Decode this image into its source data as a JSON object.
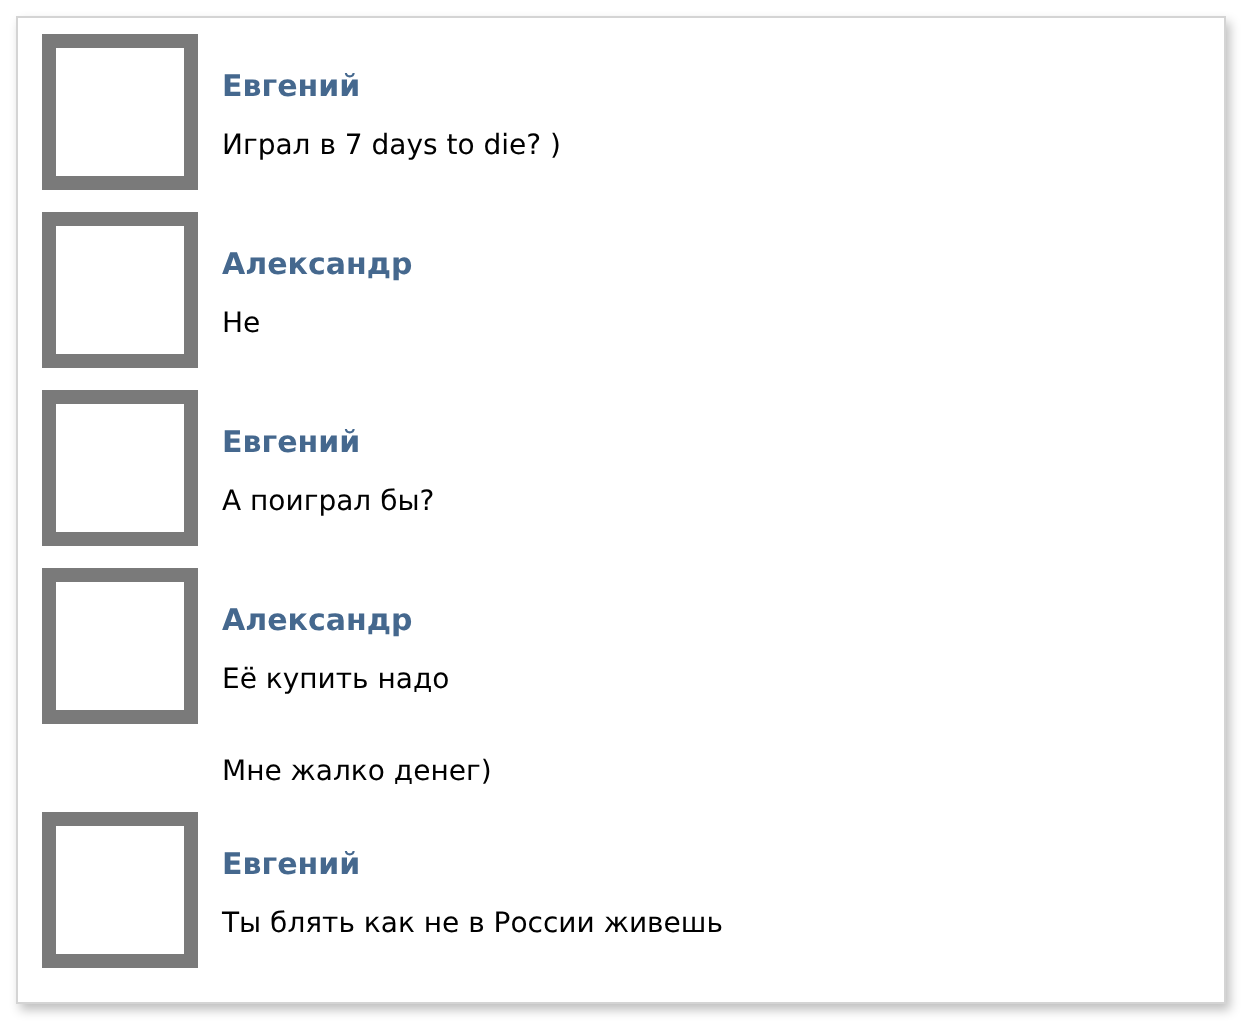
{
  "messages": [
    {
      "author": "Евгений",
      "texts": [
        "Играл в 7 days to die? )"
      ]
    },
    {
      "author": "Александр",
      "texts": [
        "Не"
      ]
    },
    {
      "author": "Евгений",
      "texts": [
        "А поиграл бы?"
      ]
    },
    {
      "author": "Александр",
      "texts": [
        "Её купить надо",
        "Мне жалко денег)"
      ]
    },
    {
      "author": "Евгений",
      "texts": [
        "Ты блять как не в России живешь"
      ]
    }
  ]
}
